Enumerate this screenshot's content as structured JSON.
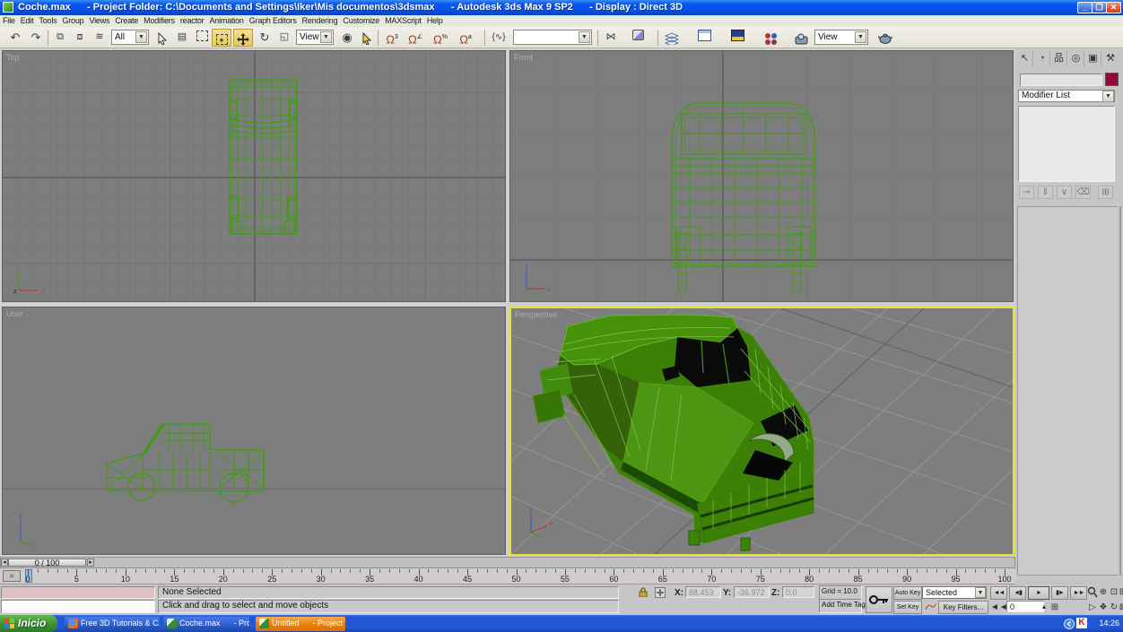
{
  "window": {
    "title": "Coche.max      - Project Folder: C:\\Documents and Settings\\Iker\\Mis documentos\\3dsmax      - Autodesk 3ds Max 9 SP2      - Display : Direct 3D"
  },
  "menu": {
    "items": [
      "File",
      "Edit",
      "Tools",
      "Group",
      "Views",
      "Create",
      "Modifiers",
      "reactor",
      "Animation",
      "Graph Editors",
      "Rendering",
      "Customize",
      "MAXScript",
      "Help"
    ]
  },
  "toolbar": {
    "filter_dropdown": "All",
    "coord_dropdown": "View",
    "named_selection": "",
    "render_dropdown": "View"
  },
  "viewports": {
    "top": "Top",
    "front": "Front",
    "user": "User",
    "perspective": "Perspective",
    "axis_x": "x",
    "axis_y": "y",
    "axis_z": "z"
  },
  "command_panel": {
    "object_name": "",
    "modifier_list": "Modifier List",
    "swatch_color": "#930738"
  },
  "timeline": {
    "slider_label": "0 / 100",
    "start": 0,
    "end": 100,
    "label_step": 5,
    "current_frame": 0
  },
  "status": {
    "selection": "None Selected",
    "prompt": "Click and drag to select and move objects",
    "x_label": "X:",
    "x_value": "88.453",
    "y_label": "Y:",
    "y_value": "-36.972",
    "z_label": "Z:",
    "z_value": "0.0",
    "grid": "Grid = 10.0",
    "add_time_tag": "Add Time Tag",
    "auto_key": "Auto Key",
    "set_key": "Set Key",
    "key_mode": "Selected",
    "key_filters": "Key Filters...",
    "frame_field": "0"
  },
  "taskbar": {
    "start_label": "Inicio",
    "buttons": [
      {
        "label": "Free 3D Tutorials & C...",
        "icon": "firefox",
        "active": false
      },
      {
        "label": "Coche.max      - Proje...",
        "icon": "3dsmax",
        "active": false
      },
      {
        "label": "Untitled      - Project ...",
        "icon": "3dsmax",
        "active": true
      }
    ],
    "tray_time": "14:26",
    "tray_icon_letter": "K"
  },
  "colors": {
    "titlebar_blue": "#0750eb",
    "viewport_gray": "#7d7d7d",
    "wireframe_green": "#3f9e0e",
    "active_viewport_border": "#e8e228",
    "taskbar_blue": "#2458d4",
    "active_task_orange": "#e67c02",
    "pressed_button_yellow": "#e9d26a",
    "swatch_maroon": "#930738"
  }
}
